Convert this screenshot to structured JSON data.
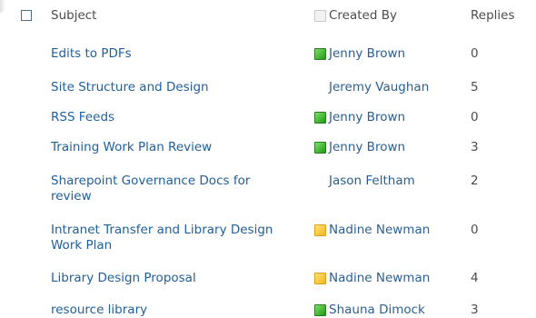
{
  "header": {
    "subject": "Subject",
    "created_by": "Created By",
    "replies": "Replies"
  },
  "rows": [
    {
      "subject": "Edits to PDFs",
      "created_by": "Jenny Brown",
      "presence": "online",
      "replies": "0"
    },
    {
      "subject": "Site Structure and Design",
      "created_by": "Jeremy Vaughan",
      "presence": "none",
      "replies": "5"
    },
    {
      "subject": "RSS Feeds",
      "created_by": "Jenny Brown",
      "presence": "online",
      "replies": "0"
    },
    {
      "subject": "Training Work Plan Review",
      "created_by": "Jenny Brown",
      "presence": "online",
      "replies": "3"
    },
    {
      "subject": "Sharepoint Governance Docs for review",
      "created_by": "Jason Feltham",
      "presence": "none",
      "replies": "2"
    },
    {
      "subject": "Intranet Transfer and Library Design Work Plan",
      "created_by": "Nadine Newman",
      "presence": "away",
      "replies": "0"
    },
    {
      "subject": "Library Design Proposal",
      "created_by": "Nadine Newman",
      "presence": "away",
      "replies": "4"
    },
    {
      "subject": "resource library",
      "created_by": "Shauna Dimock",
      "presence": "online",
      "replies": "3"
    }
  ],
  "colors": {
    "link": "#1f5f9e",
    "presence_online": "#3cb52a",
    "presence_away": "#f7c948"
  }
}
